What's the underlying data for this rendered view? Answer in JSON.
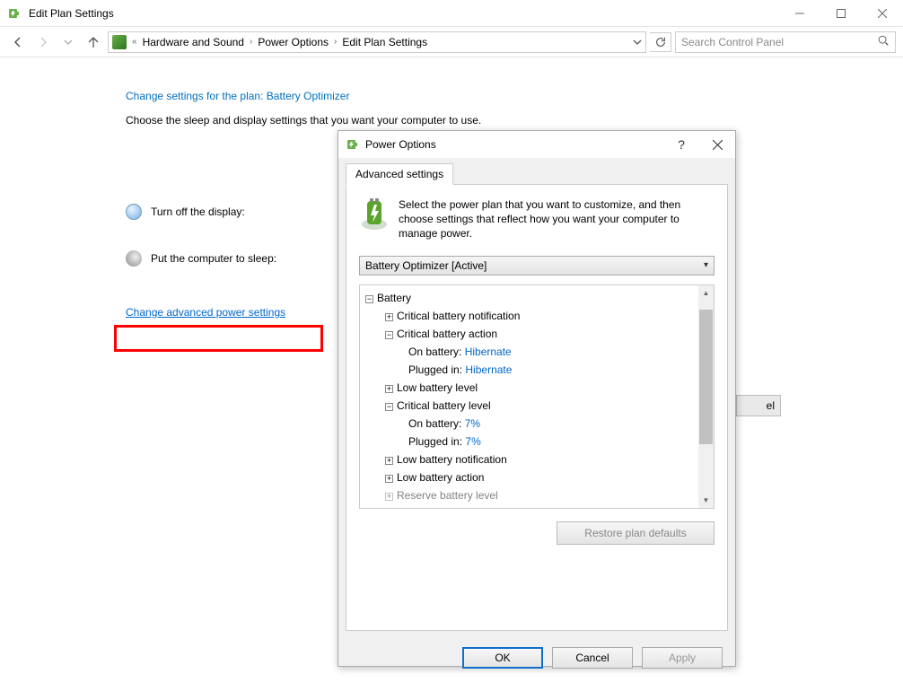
{
  "window": {
    "title": "Edit Plan Settings"
  },
  "breadcrumb": {
    "items": [
      "Hardware and Sound",
      "Power Options",
      "Edit Plan Settings"
    ]
  },
  "search": {
    "placeholder": "Search Control Panel"
  },
  "page": {
    "heading_prefix": "Change settings for the plan: ",
    "plan_name": "Battery Optimizer",
    "subhead": "Choose the sleep and display settings that you want your computer to use.",
    "display_label": "Turn off the display:",
    "sleep_label": "Put the computer to sleep:",
    "advanced_link": "Change advanced power settings"
  },
  "dialog": {
    "title": "Power Options",
    "tab": "Advanced settings",
    "hint": "Select the power plan that you want to customize, and then choose settings that reflect how you want your computer to manage power.",
    "plan_selected": "Battery Optimizer [Active]",
    "restore": "Restore plan defaults",
    "ok": "OK",
    "cancel": "Cancel",
    "apply": "Apply",
    "tree": {
      "battery": "Battery",
      "crit_notif": "Critical battery notification",
      "crit_action": "Critical battery action",
      "crit_action_onbatt_label": "On battery: ",
      "crit_action_onbatt_val": "Hibernate",
      "crit_action_plugged_label": "Plugged in: ",
      "crit_action_plugged_val": "Hibernate",
      "low_level": "Low battery level",
      "crit_level": "Critical battery level",
      "crit_level_onbatt_label": "On battery: ",
      "crit_level_onbatt_val": "7%",
      "crit_level_plugged_label": "Plugged in: ",
      "crit_level_plugged_val": "7%",
      "low_notif": "Low battery notification",
      "low_action": "Low battery action",
      "reserve": "Reserve battery level"
    }
  },
  "frag": "el"
}
